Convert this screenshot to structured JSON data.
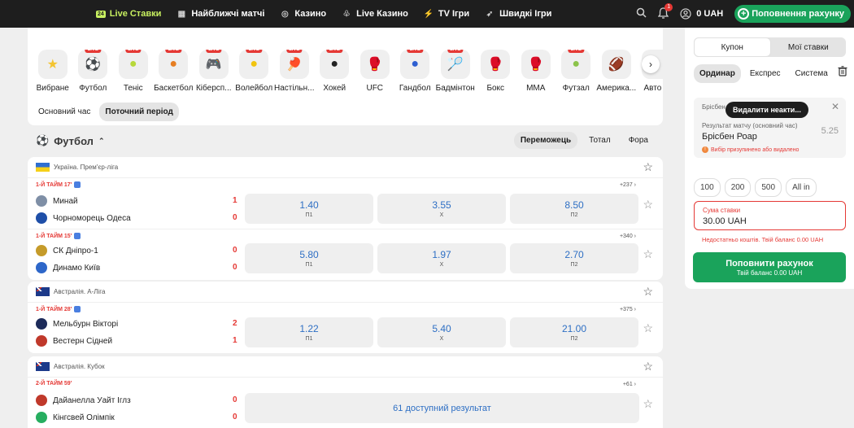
{
  "topbar": {
    "nav": [
      {
        "label": "Live Ставки",
        "icon": "live-icon",
        "badge": "24"
      },
      {
        "label": "Найближчі матчі",
        "icon": "calendar-icon"
      },
      {
        "label": "Казино",
        "icon": "casino-icon"
      },
      {
        "label": "Live Казино",
        "icon": "live-casino-icon"
      },
      {
        "label": "TV Ігри",
        "icon": "tv-games-icon"
      },
      {
        "label": "Швидкі Ігри",
        "icon": "quick-games-icon"
      }
    ],
    "notifications": "1",
    "balance": "0 UAH",
    "deposit_label": "Поповнення рахунку"
  },
  "sports": [
    {
      "label": "Вибране",
      "icon": "★",
      "live": false,
      "bg": "#f4c430"
    },
    {
      "label": "Футбол",
      "icon": "⚽",
      "live": true
    },
    {
      "label": "Теніс",
      "icon": "●",
      "live": true,
      "color": "#b7d83a"
    },
    {
      "label": "Баскетбол",
      "icon": "●",
      "live": true,
      "color": "#e67e22"
    },
    {
      "label": "Кіберсп...",
      "icon": "🎮",
      "live": true
    },
    {
      "label": "Волейбол",
      "icon": "●",
      "live": true,
      "color": "#f1c40f"
    },
    {
      "label": "Настільн...",
      "icon": "🏓",
      "live": true
    },
    {
      "label": "Хокей",
      "icon": "●",
      "live": true,
      "color": "#222"
    },
    {
      "label": "UFC",
      "icon": "🥊",
      "live": false
    },
    {
      "label": "Гандбол",
      "icon": "●",
      "live": true,
      "color": "#2e5fd1"
    },
    {
      "label": "Бадмінтон",
      "icon": "🏸",
      "live": true
    },
    {
      "label": "Бокс",
      "icon": "🥊",
      "live": false
    },
    {
      "label": "MMA",
      "icon": "🥊",
      "live": false
    },
    {
      "label": "Футзал",
      "icon": "●",
      "live": true,
      "color": "#8bc34a"
    },
    {
      "label": "Америка...",
      "icon": "🏈",
      "live": false
    },
    {
      "label": "Авто м",
      "icon": "",
      "live": false
    }
  ],
  "sport_live_label": "LIVE",
  "period_tabs": [
    "Основний час",
    "Поточний період"
  ],
  "sport_section": {
    "title": "Футбол",
    "market_tabs": [
      "Переможець",
      "Тотал",
      "Фора"
    ]
  },
  "leagues": [
    {
      "name": "Україна. Прем'єр-ліга",
      "flag": "ua",
      "matches": [
        {
          "time": "1-Й ТАЙМ 17'",
          "more": "+237 ›",
          "home": "Минай",
          "away": "Чорноморець Одеса",
          "home_score": "1",
          "away_score": "0",
          "home_color": "#7f8fa6",
          "away_color": "#1f4fa8",
          "odds": [
            {
              "v": "1.40",
              "l": "П1"
            },
            {
              "v": "3.55",
              "l": "Х"
            },
            {
              "v": "8.50",
              "l": "П2"
            }
          ]
        },
        {
          "time": "1-Й ТАЙМ 15'",
          "more": "+340 ›",
          "home": "СК Дніпро-1",
          "away": "Динамо Київ",
          "home_score": "0",
          "away_score": "0",
          "home_color": "#c59b2a",
          "away_color": "#2e67c9",
          "odds": [
            {
              "v": "5.80",
              "l": "П1"
            },
            {
              "v": "1.97",
              "l": "Х"
            },
            {
              "v": "2.70",
              "l": "П2"
            }
          ]
        }
      ]
    },
    {
      "name": "Австралія. А-Ліга",
      "flag": "au",
      "matches": [
        {
          "time": "1-Й ТАЙМ 28'",
          "more": "+375 ›",
          "home": "Мельбурн Вікторі",
          "away": "Вестерн Сідней",
          "home_score": "2",
          "away_score": "1",
          "home_color": "#1d2b5a",
          "away_color": "#c0392b",
          "odds": [
            {
              "v": "1.22",
              "l": "П1"
            },
            {
              "v": "5.40",
              "l": "Х"
            },
            {
              "v": "21.00",
              "l": "П2"
            }
          ]
        }
      ]
    },
    {
      "name": "Австралія. Кубок",
      "flag": "au",
      "matches": [
        {
          "time": "2-Й ТАЙМ 59'",
          "more": "+61 ›",
          "home": "Дайанелла Уайт Іглз",
          "away": "Кінгсвей Олімпік",
          "home_score": "0",
          "away_score": "0",
          "home_color": "#c0392b",
          "away_color": "#27ae60",
          "wide": "61 доступний результат"
        }
      ]
    }
  ],
  "coupon": {
    "tabs": [
      "Купон",
      "Мої ставки"
    ],
    "bet_types": [
      "Ординар",
      "Експрес",
      "Система"
    ],
    "league": "Брісбен",
    "tooltip": "Видалити неакти...",
    "market": "Результат матчу (основний час)",
    "selection": "Брісбен Роар",
    "odd": "5.25",
    "warning": "Вибір призупинено або видалено",
    "quick_amounts": [
      "100",
      "200",
      "500",
      "All in"
    ],
    "stake_label": "Сума ставки",
    "stake_value": "30.00 UAH",
    "error": "Недостатньо коштів. Твій баланс 0.00 UAH",
    "deposit_label": "Поповнити рахунок",
    "deposit_sub": "Твій баланс 0.00 UAH"
  },
  "colors": {
    "accent_green": "#1aa35b",
    "live_red": "#e53935",
    "odds_blue": "#2e6fc4"
  }
}
